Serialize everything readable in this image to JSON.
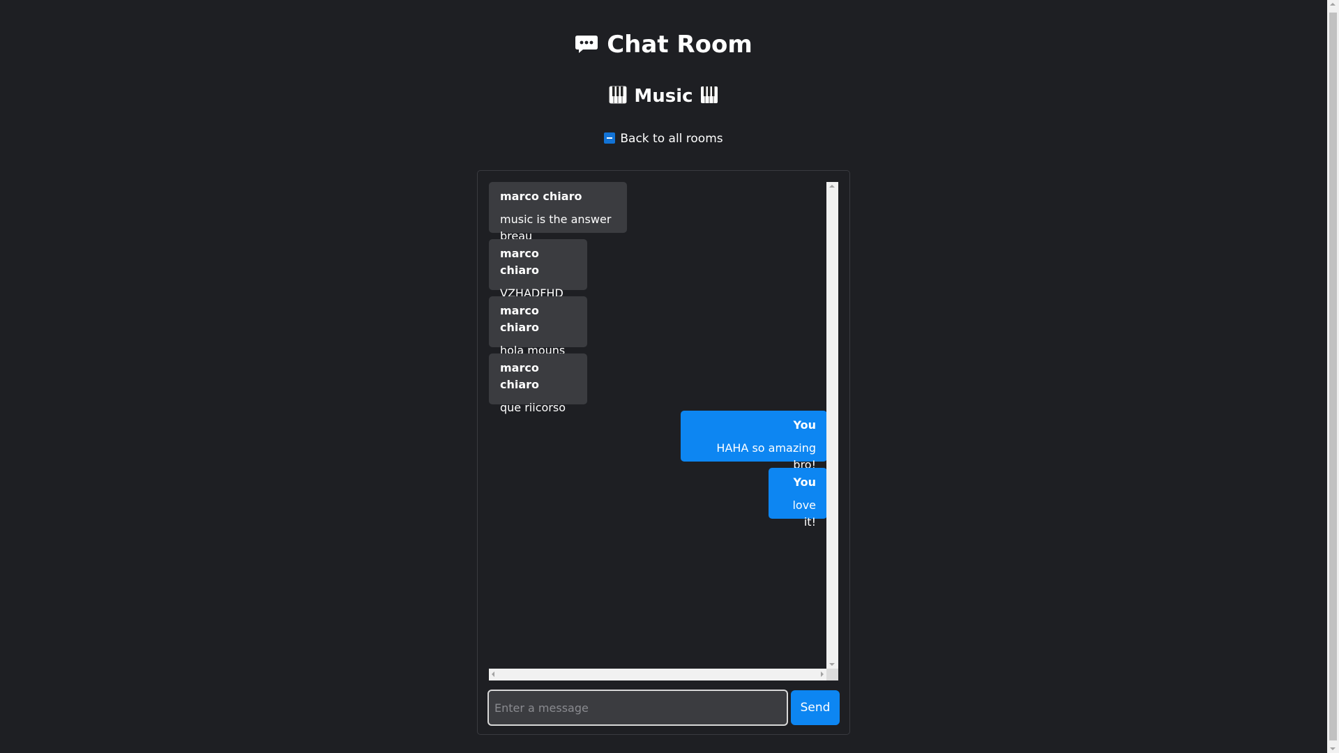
{
  "header": {
    "title": "Chat Room",
    "title_icon": "speech-bubble-icon"
  },
  "room": {
    "name": "Music",
    "icon": "piano-keys-icon"
  },
  "back_link": {
    "label": "Back to all rooms",
    "icon": "back-arrow-icon"
  },
  "messages": [
    {
      "sender": "marco chiaro",
      "text": "music is the answer breau",
      "direction": "incoming"
    },
    {
      "sender": "marco chiaro",
      "text": "VZHADFHD",
      "direction": "incoming"
    },
    {
      "sender": "marco chiaro",
      "text": "hola mouns",
      "direction": "incoming"
    },
    {
      "sender": "marco chiaro",
      "text": "que riicorso",
      "direction": "incoming"
    },
    {
      "sender": "You",
      "text": "HAHA so amazing bro!",
      "direction": "outgoing"
    },
    {
      "sender": "You",
      "text": "love it!",
      "direction": "outgoing"
    }
  ],
  "composer": {
    "placeholder": "Enter a message",
    "value": "",
    "send_label": "Send"
  },
  "colors": {
    "background": "#1e1f23",
    "incoming_bubble": "#3b3c40",
    "outgoing_bubble": "#0d86f2",
    "accent": "#0d86f2"
  }
}
